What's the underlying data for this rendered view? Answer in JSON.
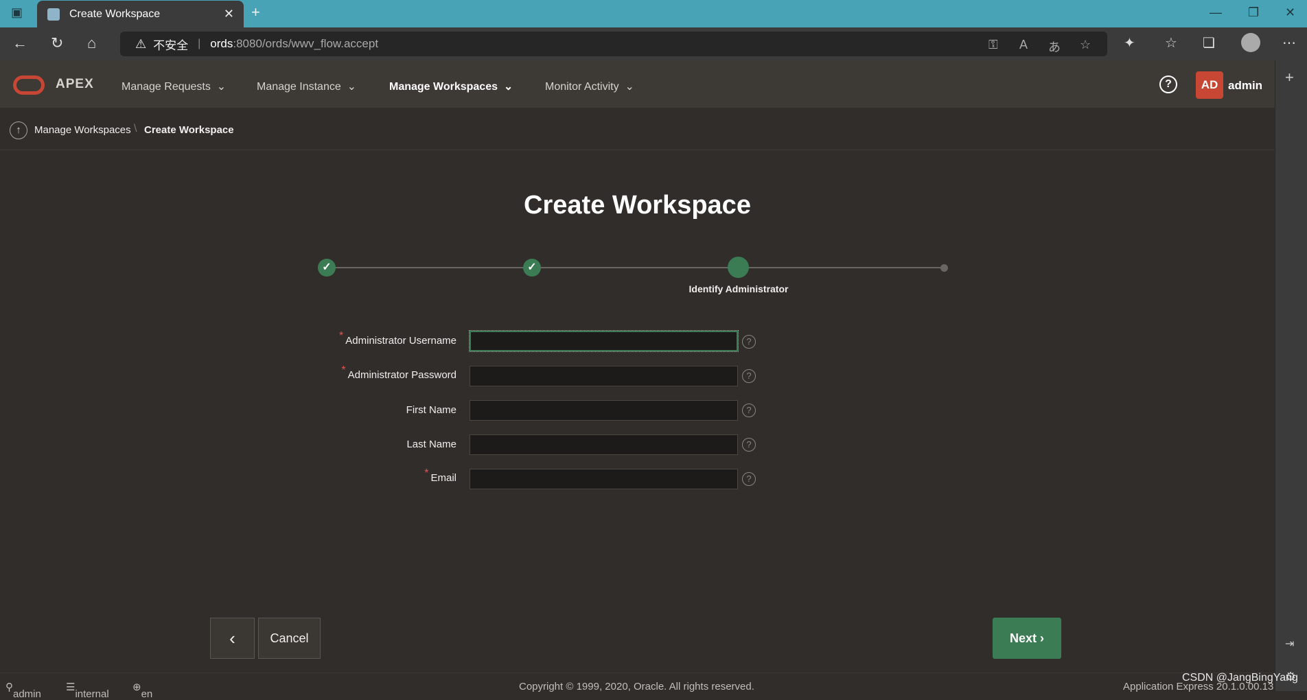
{
  "browser": {
    "tab_title": "Create Workspace",
    "new_tab": "+",
    "address_insecure": "不安全",
    "address_host": "ords",
    "address_path": ":8080/ords/wwv_flow.accept"
  },
  "app": {
    "brand": "APEX",
    "menu": [
      "Manage Requests",
      "Manage Instance",
      "Manage Workspaces",
      "Monitor Activity"
    ],
    "avatar_initials": "AD",
    "user": "admin"
  },
  "breadcrumb": {
    "parent": "Manage Workspaces",
    "current": "Create Workspace"
  },
  "page": {
    "title": "Create Workspace",
    "current_step_label": "Identify Administrator",
    "fields": [
      {
        "label": "Administrator Username",
        "required": true,
        "value": ""
      },
      {
        "label": "Administrator Password",
        "required": true,
        "value": ""
      },
      {
        "label": "First Name",
        "required": false,
        "value": ""
      },
      {
        "label": "Last Name",
        "required": false,
        "value": ""
      },
      {
        "label": "Email",
        "required": true,
        "value": ""
      }
    ],
    "buttons": {
      "back": "‹",
      "cancel": "Cancel",
      "next": "Next"
    }
  },
  "footer": {
    "user": "admin",
    "schema": "internal",
    "language": "en",
    "copyright": "Copyright © 1999, 2020, Oracle. All rights reserved.",
    "version": "Application Express 20.1.0.00.13"
  },
  "watermark": "CSDN @JangBingYang"
}
